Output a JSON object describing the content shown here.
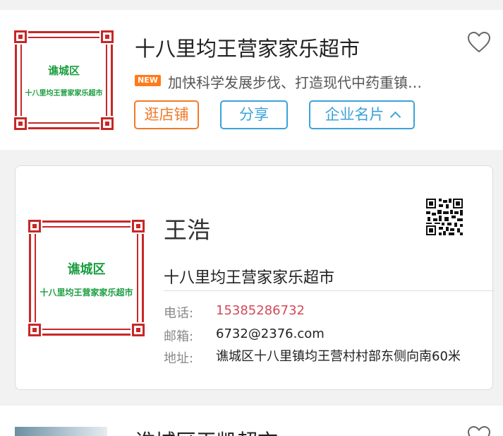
{
  "shop": {
    "logo_line1": "谯城区",
    "logo_line2": "十八里均王营家家乐超市",
    "title": "十八里均王营家家乐超市",
    "new_badge": "NEW",
    "news": "加快科学发展步伐、打造现代中药重镇…",
    "buttons": {
      "visit": "逛店铺",
      "share": "分享",
      "card": "企业名片"
    }
  },
  "business_card": {
    "logo_line1": "谯城区",
    "logo_line2": "十八里均王营家家乐超市",
    "name": "王浩",
    "company": "十八里均王营家家乐超市",
    "phone_label": "电话:",
    "phone": "15385286732",
    "email_label": "邮箱:",
    "email": "6732@2376.com",
    "address_label": "地址:",
    "address": "谯城区十八里镇均王营村村部东侧向南60米"
  },
  "next_shop": {
    "title": "谯城区玉凯超市"
  },
  "colors": {
    "accent_blue": "#3ba2db",
    "accent_orange": "#f07a2a",
    "logo_red": "#c62828",
    "logo_green": "#1a9d3f",
    "phone_red": "#d14a5a"
  }
}
